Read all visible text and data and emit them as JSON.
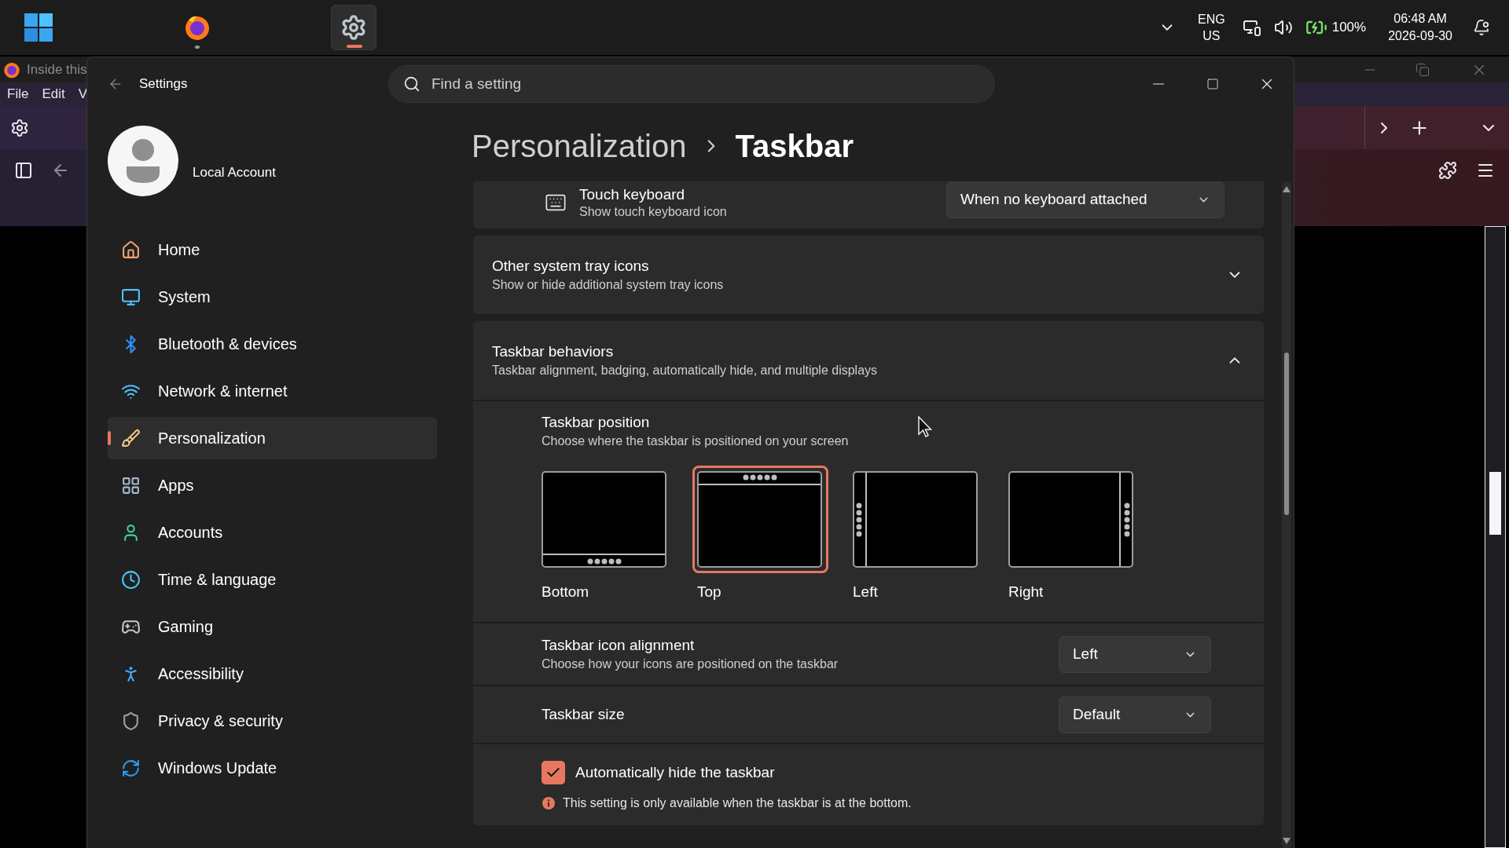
{
  "taskbar": {
    "apps": [
      {
        "kind": "start",
        "selected": false,
        "running": false
      },
      {
        "kind": "browser",
        "selected": false,
        "running": true
      },
      {
        "kind": "settings",
        "selected": true,
        "running": true
      }
    ],
    "language": "ENG",
    "region": "US",
    "battery": "100%",
    "time": "06:48 AM",
    "date": "2026-09-30"
  },
  "browser_window": {
    "title": "Inside this",
    "menu": [
      "File",
      "Edit",
      "V"
    ]
  },
  "settings": {
    "title": "Settings",
    "search": {
      "placeholder": "Find a setting"
    },
    "account": "Local Account",
    "nav": [
      {
        "kind": "home",
        "label": "Home",
        "selected": false
      },
      {
        "kind": "system",
        "label": "System",
        "selected": false
      },
      {
        "kind": "bluetooth",
        "label": "Bluetooth & devices",
        "selected": false
      },
      {
        "kind": "network",
        "label": "Network & internet",
        "selected": false
      },
      {
        "kind": "personalization",
        "label": "Personalization",
        "selected": true
      },
      {
        "kind": "apps",
        "label": "Apps",
        "selected": false
      },
      {
        "kind": "accounts",
        "label": "Accounts",
        "selected": false
      },
      {
        "kind": "time",
        "label": "Time & language",
        "selected": false
      },
      {
        "kind": "gaming",
        "label": "Gaming",
        "selected": false
      },
      {
        "kind": "accessibility",
        "label": "Accessibility",
        "selected": false
      },
      {
        "kind": "privacy",
        "label": "Privacy & security",
        "selected": false
      },
      {
        "kind": "update",
        "label": "Windows Update",
        "selected": false
      }
    ],
    "breadcrumb": [
      "Personalization",
      "Taskbar"
    ],
    "sections": [
      {
        "kind": "keyboard",
        "title": "Touch keyboard",
        "subtitle": "Show touch keyboard icon",
        "value": "When no keyboard attached"
      },
      {
        "kind": "expander",
        "title": "Other system tray icons",
        "subtitle": "Show or hide additional system tray icons",
        "expanded": false
      },
      {
        "kind": "expander",
        "title": "Taskbar behaviors",
        "subtitle": "Taskbar alignment, badging, automatically hide, and multiple displays",
        "expanded": true,
        "children": [
          {
            "kind": "position",
            "title": "Taskbar position",
            "subtitle": "Choose where the taskbar is positioned on your screen",
            "options": [
              {
                "kind": "bottom",
                "label": "Bottom",
                "selected": false
              },
              {
                "kind": "top",
                "label": "Top",
                "selected": true
              },
              {
                "kind": "left",
                "label": "Left",
                "selected": false
              },
              {
                "kind": "right",
                "label": "Right",
                "selected": false
              }
            ]
          },
          {
            "kind": "select",
            "title": "Taskbar icon alignment",
            "subtitle": "Choose how your icons are positioned on the taskbar",
            "value": "Left"
          },
          {
            "kind": "select",
            "title": "Taskbar size",
            "value": "Default"
          },
          {
            "kind": "checkbox",
            "label": "Automatically hide the taskbar",
            "checked": true,
            "note": "This setting is only available when the taskbar is at the bottom."
          }
        ]
      }
    ]
  }
}
